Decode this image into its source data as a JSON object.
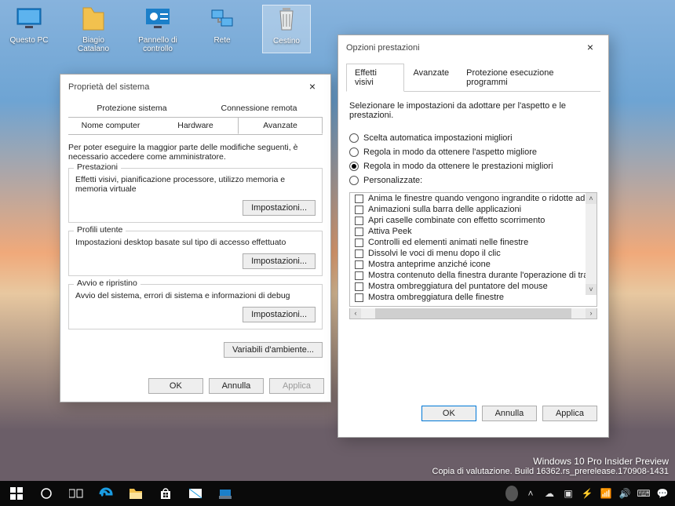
{
  "desktop": {
    "icons": [
      {
        "label": "Questo PC",
        "kind": "pc"
      },
      {
        "label": "Biagio Catalano",
        "kind": "user"
      },
      {
        "label": "Pannello di controllo",
        "kind": "control"
      },
      {
        "label": "Rete",
        "kind": "net"
      },
      {
        "label": "Cestino",
        "kind": "bin"
      }
    ]
  },
  "sysprops": {
    "title": "Proprietà del sistema",
    "tabs_row1": [
      "Protezione sistema",
      "Connessione remota"
    ],
    "tabs_row2": [
      "Nome computer",
      "Hardware",
      "Avanzate"
    ],
    "active_tab": "Avanzate",
    "note": "Per poter eseguire la maggior parte delle modifiche seguenti, è necessario accedere come amministratore.",
    "groups": [
      {
        "legend": "Prestazioni",
        "desc": "Effetti visivi, pianificazione processore, utilizzo memoria e memoria virtuale",
        "btn": "Impostazioni..."
      },
      {
        "legend": "Profili utente",
        "desc": "Impostazioni desktop basate sul tipo di accesso effettuato",
        "btn": "Impostazioni..."
      },
      {
        "legend": "Avvio e ripristino",
        "desc": "Avvio del sistema, errori di sistema e informazioni di debug",
        "btn": "Impostazioni..."
      }
    ],
    "env_btn": "Variabili d'ambiente...",
    "footer": {
      "ok": "OK",
      "cancel": "Annulla",
      "apply": "Applica"
    }
  },
  "perf": {
    "title": "Opzioni prestazioni",
    "tabs": [
      "Effetti visivi",
      "Avanzate",
      "Protezione esecuzione programmi"
    ],
    "active_tab": "Effetti visivi",
    "intro": "Selezionare le impostazioni da adottare per l'aspetto e le prestazioni.",
    "radios": [
      {
        "label": "Scelta automatica impostazioni migliori",
        "checked": false
      },
      {
        "label": "Regola in modo da ottenere l'aspetto migliore",
        "checked": false
      },
      {
        "label": "Regola in modo da ottenere le prestazioni migliori",
        "checked": true
      },
      {
        "label": "Personalizzate:",
        "checked": false
      }
    ],
    "checklist": [
      "Anima le finestre quando vengono ingrandite o ridotte ad icon",
      "Animazioni sulla barra delle applicazioni",
      "Apri caselle combinate con effetto scorrimento",
      "Attiva Peek",
      "Controlli ed elementi animati nelle finestre",
      "Dissolvi le voci di menu dopo il clic",
      "Mostra anteprime anziché icone",
      "Mostra contenuto della finestra durante l'operazione di trascina",
      "Mostra ombreggiatura del puntatore del mouse",
      "Mostra ombreggiatura delle finestre"
    ],
    "footer": {
      "ok": "OK",
      "cancel": "Annulla",
      "apply": "Applica"
    }
  },
  "watermark": {
    "line1": "Windows 10 Pro Insider Preview",
    "line2": "Copia di valutazione. Build 16362.rs_prerelease.170908-1431"
  }
}
